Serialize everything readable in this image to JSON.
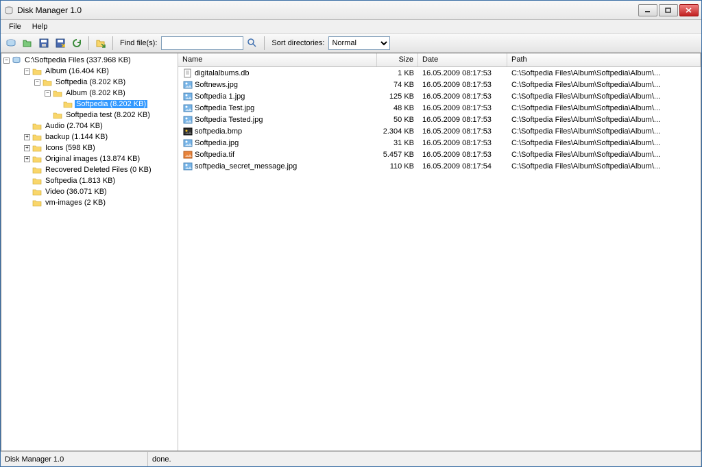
{
  "window": {
    "title": "Disk Manager 1.0"
  },
  "menu": {
    "file": "File",
    "help": "Help"
  },
  "toolbar": {
    "findfiles_label": "Find file(s):",
    "find_value": "",
    "sortdirs_label": "Sort directories:",
    "sortdirs_value": "Normal"
  },
  "tree": {
    "root": "C:\\Softpedia Files (337.968 KB)",
    "nodes": [
      {
        "indent": 1,
        "expand": "-",
        "label": "Album (16.404 KB)"
      },
      {
        "indent": 2,
        "expand": "-",
        "label": "Softpedia (8.202 KB)"
      },
      {
        "indent": 3,
        "expand": "-",
        "label": "Album (8.202 KB)"
      },
      {
        "indent": 4,
        "expand": "",
        "label": "Softpedia (8.202 KB)",
        "selected": true
      },
      {
        "indent": 3,
        "expand": "",
        "label": "Softpedia test (8.202 KB)"
      },
      {
        "indent": 1,
        "expand": "",
        "label": "Audio (2.704 KB)"
      },
      {
        "indent": 1,
        "expand": "+",
        "label": "backup (1.144 KB)"
      },
      {
        "indent": 1,
        "expand": "+",
        "label": "Icons (598 KB)"
      },
      {
        "indent": 1,
        "expand": "+",
        "label": "Original images (13.874 KB)"
      },
      {
        "indent": 1,
        "expand": "",
        "label": "Recovered Deleted Files (0 KB)"
      },
      {
        "indent": 1,
        "expand": "",
        "label": "Softpedia (1.813 KB)"
      },
      {
        "indent": 1,
        "expand": "",
        "label": "Video (36.071 KB)"
      },
      {
        "indent": 1,
        "expand": "",
        "label": "vm-images (2 KB)"
      }
    ]
  },
  "columns": {
    "name": "Name",
    "size": "Size",
    "date": "Date",
    "path": "Path"
  },
  "files": [
    {
      "icon": "db",
      "name": "digitalalbums.db",
      "size": "1 KB",
      "date": "16.05.2009 08:17:53",
      "path": "C:\\Softpedia Files\\Album\\Softpedia\\Album\\..."
    },
    {
      "icon": "jpg",
      "name": "Softnews.jpg",
      "size": "74 KB",
      "date": "16.05.2009 08:17:53",
      "path": "C:\\Softpedia Files\\Album\\Softpedia\\Album\\..."
    },
    {
      "icon": "jpg",
      "name": "Softpedia 1.jpg",
      "size": "125 KB",
      "date": "16.05.2009 08:17:53",
      "path": "C:\\Softpedia Files\\Album\\Softpedia\\Album\\..."
    },
    {
      "icon": "jpg",
      "name": "Softpedia Test.jpg",
      "size": "48 KB",
      "date": "16.05.2009 08:17:53",
      "path": "C:\\Softpedia Files\\Album\\Softpedia\\Album\\..."
    },
    {
      "icon": "jpg",
      "name": "Softpedia Tested.jpg",
      "size": "50 KB",
      "date": "16.05.2009 08:17:53",
      "path": "C:\\Softpedia Files\\Album\\Softpedia\\Album\\..."
    },
    {
      "icon": "bmp",
      "name": "softpedia.bmp",
      "size": "2.304 KB",
      "date": "16.05.2009 08:17:53",
      "path": "C:\\Softpedia Files\\Album\\Softpedia\\Album\\..."
    },
    {
      "icon": "jpg",
      "name": "Softpedia.jpg",
      "size": "31 KB",
      "date": "16.05.2009 08:17:53",
      "path": "C:\\Softpedia Files\\Album\\Softpedia\\Album\\..."
    },
    {
      "icon": "tif",
      "name": "Softpedia.tif",
      "size": "5.457 KB",
      "date": "16.05.2009 08:17:53",
      "path": "C:\\Softpedia Files\\Album\\Softpedia\\Album\\..."
    },
    {
      "icon": "jpg",
      "name": "softpedia_secret_message.jpg",
      "size": "110 KB",
      "date": "16.05.2009 08:17:54",
      "path": "C:\\Softpedia Files\\Album\\Softpedia\\Album\\..."
    }
  ],
  "status": {
    "app": "Disk Manager 1.0",
    "msg": "done."
  }
}
